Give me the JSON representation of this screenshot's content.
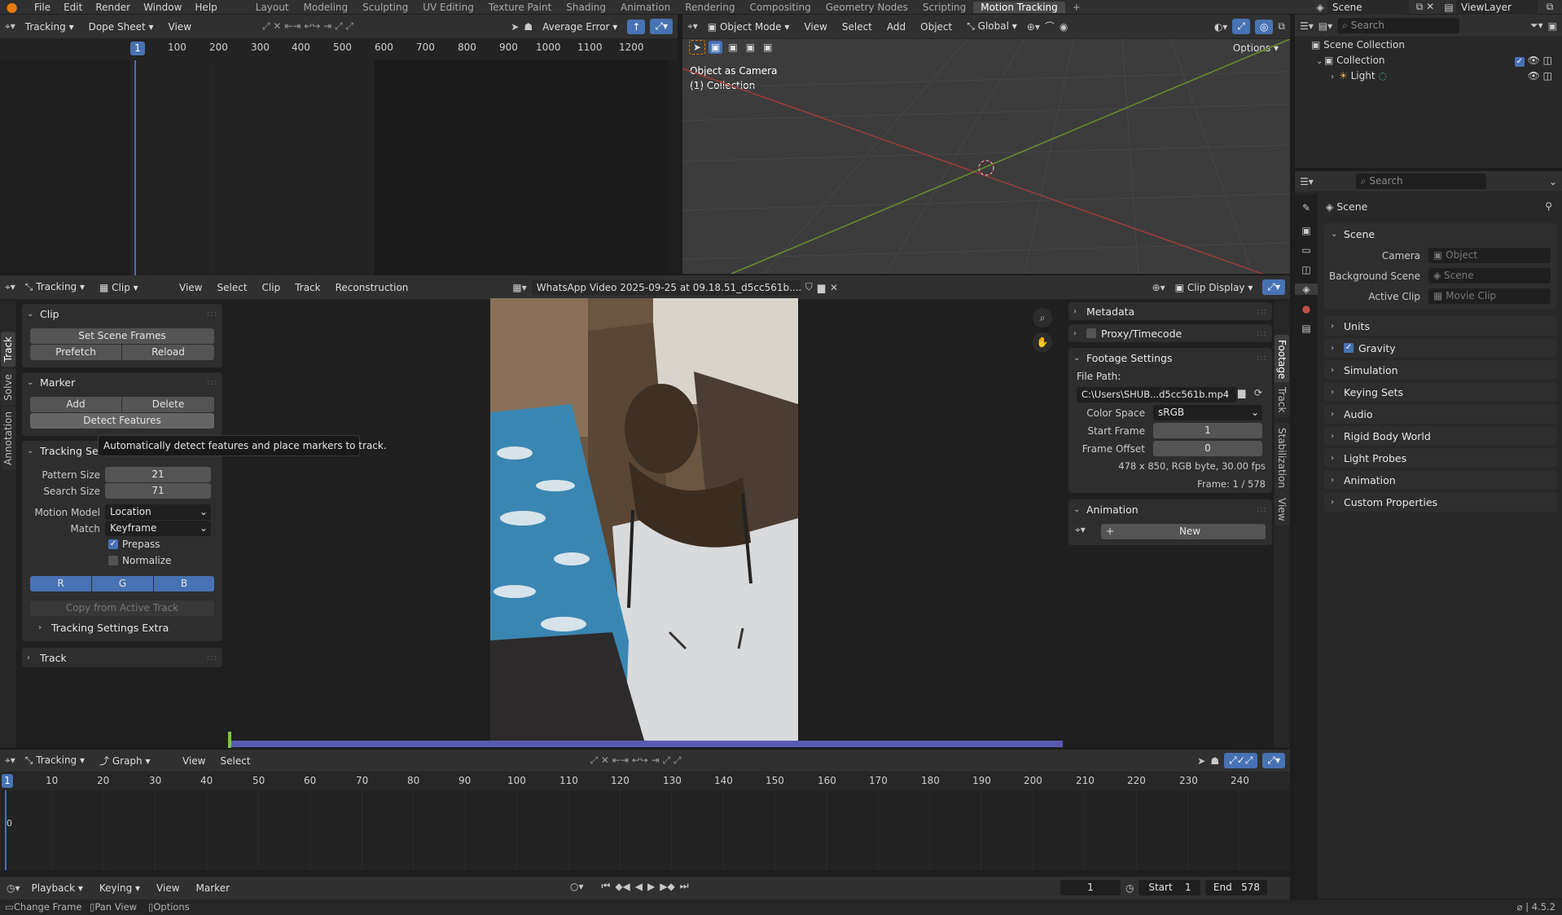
{
  "topbar": {
    "menus": [
      "File",
      "Edit",
      "Render",
      "Window",
      "Help"
    ],
    "workspaces": [
      "Layout",
      "Modeling",
      "Sculpting",
      "UV Editing",
      "Texture Paint",
      "Shading",
      "Animation",
      "Rendering",
      "Compositing",
      "Geometry Nodes",
      "Scripting",
      "Motion Tracking"
    ],
    "active_workspace": "Motion Tracking",
    "scene": "Scene",
    "view_layer": "ViewLayer"
  },
  "dopesheet": {
    "mode": "Tracking",
    "view_type": "Dope Sheet",
    "view": "View",
    "sort": "Average Error",
    "frame_ticks": [
      "1",
      "100",
      "200",
      "300",
      "400",
      "500",
      "600",
      "700",
      "800",
      "900",
      "1000",
      "1100",
      "1200"
    ]
  },
  "viewport": {
    "mode": "Object Mode",
    "menus": [
      "View",
      "Select",
      "Add",
      "Object"
    ],
    "transform": "Global",
    "options": "Options",
    "overlay_title": "Object as Camera",
    "overlay_sub": "(1) Collection"
  },
  "outliner": {
    "search": "Search",
    "items": [
      {
        "label": "Scene Collection"
      },
      {
        "label": "Collection"
      },
      {
        "label": "Light"
      }
    ]
  },
  "properties": {
    "search": "Search",
    "title": "Scene",
    "section": "Scene",
    "camera_label": "Camera",
    "camera_value": "Object",
    "bg_label": "Background Scene",
    "bg_value": "Scene",
    "clip_label": "Active Clip",
    "clip_value": "Movie Clip",
    "sections": [
      "Units",
      "Gravity",
      "Simulation",
      "Keying Sets",
      "Audio",
      "Rigid Body World",
      "Light Probes",
      "Animation",
      "Custom Properties"
    ]
  },
  "clip_editor": {
    "mode": "Tracking",
    "view_type": "Clip",
    "menus": [
      "View",
      "Select",
      "Clip",
      "Track",
      "Reconstruction"
    ],
    "clip_name": "WhatsApp Video 2025-09-25 at 09.18.51_d5cc561b....",
    "display": "Clip Display",
    "side_tabs": [
      "Track",
      "Solve",
      "Annotation"
    ],
    "right_tabs": [
      "Footage",
      "Track",
      "Stabilization",
      "View"
    ]
  },
  "tool_panel": {
    "clip_header": "Clip",
    "set_scene_frames": "Set Scene Frames",
    "prefetch": "Prefetch",
    "reload": "Reload",
    "marker_header": "Marker",
    "add": "Add",
    "delete": "Delete",
    "detect": "Detect Features",
    "tracking_header": "Tracking Set",
    "tooltip": "Automatically detect features and place markers to track.",
    "pattern_label": "Pattern Size",
    "pattern_value": "21",
    "search_label": "Search Size",
    "search_value": "71",
    "motion_label": "Motion Model",
    "motion_value": "Location",
    "match_label": "Match",
    "match_value": "Keyframe",
    "prepass": "Prepass",
    "normalize": "Normalize",
    "r": "R",
    "g": "G",
    "b": "B",
    "copy": "Copy from Active Track",
    "extra": "Tracking Settings Extra",
    "track": "Track"
  },
  "footage": {
    "metadata": "Metadata",
    "proxy": "Proxy/Timecode",
    "settings": "Footage Settings",
    "file_label": "File Path:",
    "file_value": "C:\\Users\\SHUB...d5cc561b.mp4",
    "cs_label": "Color Space",
    "cs_value": "sRGB",
    "start_label": "Start Frame",
    "start_value": "1",
    "offset_label": "Frame Offset",
    "offset_value": "0",
    "info": "478 x 850, RGB byte, 30.00 fps",
    "frame": "Frame: 1 / 578",
    "anim_header": "Animation",
    "new": "New"
  },
  "graph": {
    "mode": "Tracking",
    "view_type": "Graph",
    "menus": [
      "View",
      "Select"
    ],
    "ticks": [
      "1",
      "10",
      "20",
      "30",
      "40",
      "50",
      "60",
      "70",
      "80",
      "90",
      "100",
      "110",
      "120",
      "130",
      "140",
      "150",
      "160",
      "170",
      "180",
      "190",
      "200",
      "210",
      "220",
      "230",
      "240"
    ],
    "zero": "0"
  },
  "timeline": {
    "menus": [
      "Playback",
      "Keying",
      "View",
      "Marker"
    ],
    "current": "1",
    "start_label": "Start",
    "start": "1",
    "end_label": "End",
    "end": "578"
  },
  "statusbar": {
    "items": [
      "Change Frame",
      "Pan View",
      "Options"
    ],
    "version": "4.5.2"
  },
  "colors": {
    "accent": "#4772b3",
    "active_ws": "#4a4a4a",
    "x_axis": "#a13b3b",
    "y_axis": "#6a8f2a"
  }
}
